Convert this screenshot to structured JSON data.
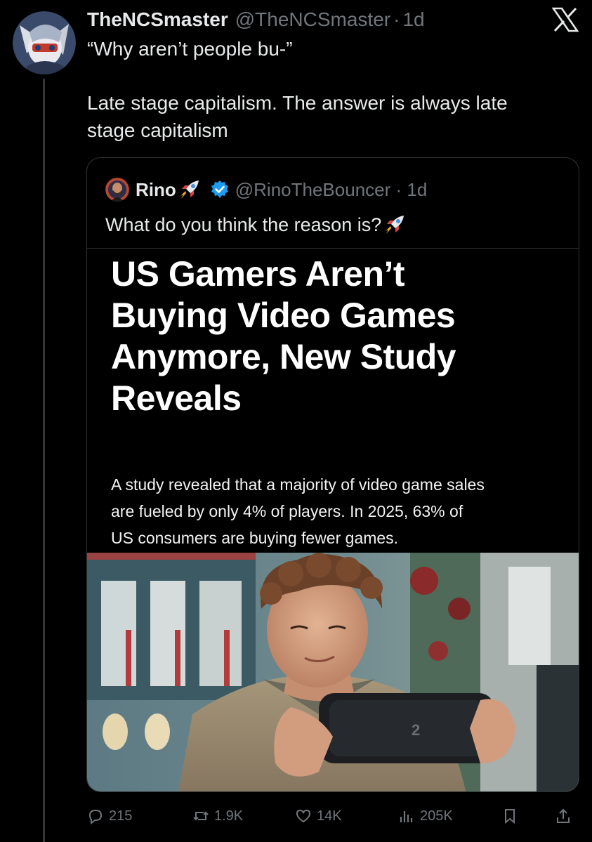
{
  "tweet": {
    "author": {
      "display_name": "TheNCSmaster",
      "handle": "@TheNCSmaster",
      "time": "1d"
    },
    "lines": [
      "“Why aren’t people bu-”",
      "",
      "Late stage capitalism. The answer is always late",
      "stage capitalism"
    ]
  },
  "quote": {
    "author": {
      "display_name": "Rino",
      "handle": "@RinoTheBouncer",
      "time": "1d",
      "verified": true
    },
    "text": "What do you think the reason is?",
    "article": {
      "headline_lines": [
        "US Gamers Aren’t",
        "Buying Video Games",
        "Anymore, New Study",
        "Reveals"
      ],
      "summary_lines": [
        "A study revealed that a majority of video game sales",
        "are fueled by only 4% of players. In 2025, 63% of",
        "US consumers are buying fewer games."
      ],
      "image_alt": "Young man smiling while playing a handheld game console",
      "console_logo_text": "2"
    }
  },
  "stats": {
    "replies": "215",
    "reposts": "1.9K",
    "likes": "14K",
    "views": "205K"
  },
  "colors": {
    "background": "#000000",
    "text_primary": "#e7e9ea",
    "text_secondary": "#71767b",
    "border": "#2f3336",
    "verified_blue": "#1d9bf0"
  },
  "icons": [
    "x-logo-icon",
    "rocket-icon",
    "verified-badge-icon",
    "reply-icon",
    "repost-icon",
    "like-icon",
    "views-icon",
    "bookmark-icon",
    "share-icon"
  ]
}
